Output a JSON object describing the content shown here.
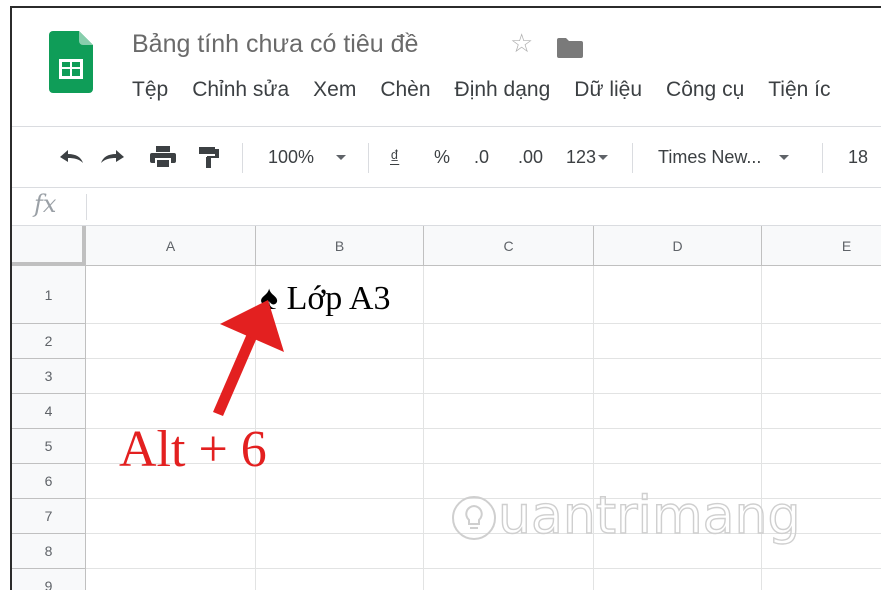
{
  "document": {
    "title": "Bảng tính chưa có tiêu đề"
  },
  "menu": {
    "items": [
      "Tệp",
      "Chỉnh sửa",
      "Xem",
      "Chèn",
      "Định dạng",
      "Dữ liệu",
      "Công cụ",
      "Tiện íc"
    ]
  },
  "toolbar": {
    "zoom": "100%",
    "currency": "₫",
    "percent": "%",
    "decrease_decimal": ".0",
    "increase_decimal": ".00",
    "more_formats": "123",
    "font": "Times New...",
    "font_size": "18"
  },
  "formula_bar": {
    "fx_label": "fx"
  },
  "grid": {
    "columns": [
      "A",
      "B",
      "C",
      "D",
      "E"
    ],
    "rows": [
      "1",
      "2",
      "3",
      "4",
      "5",
      "6",
      "7",
      "8",
      "9"
    ],
    "cell_B1": "♠ Lớp A3"
  },
  "annotation": {
    "text": "Alt + 6",
    "color": "#e32020"
  },
  "watermark": {
    "text": "uantrimang"
  },
  "colors": {
    "sheets_green": "#0f9d58",
    "header_bg": "#f8f9fa"
  }
}
